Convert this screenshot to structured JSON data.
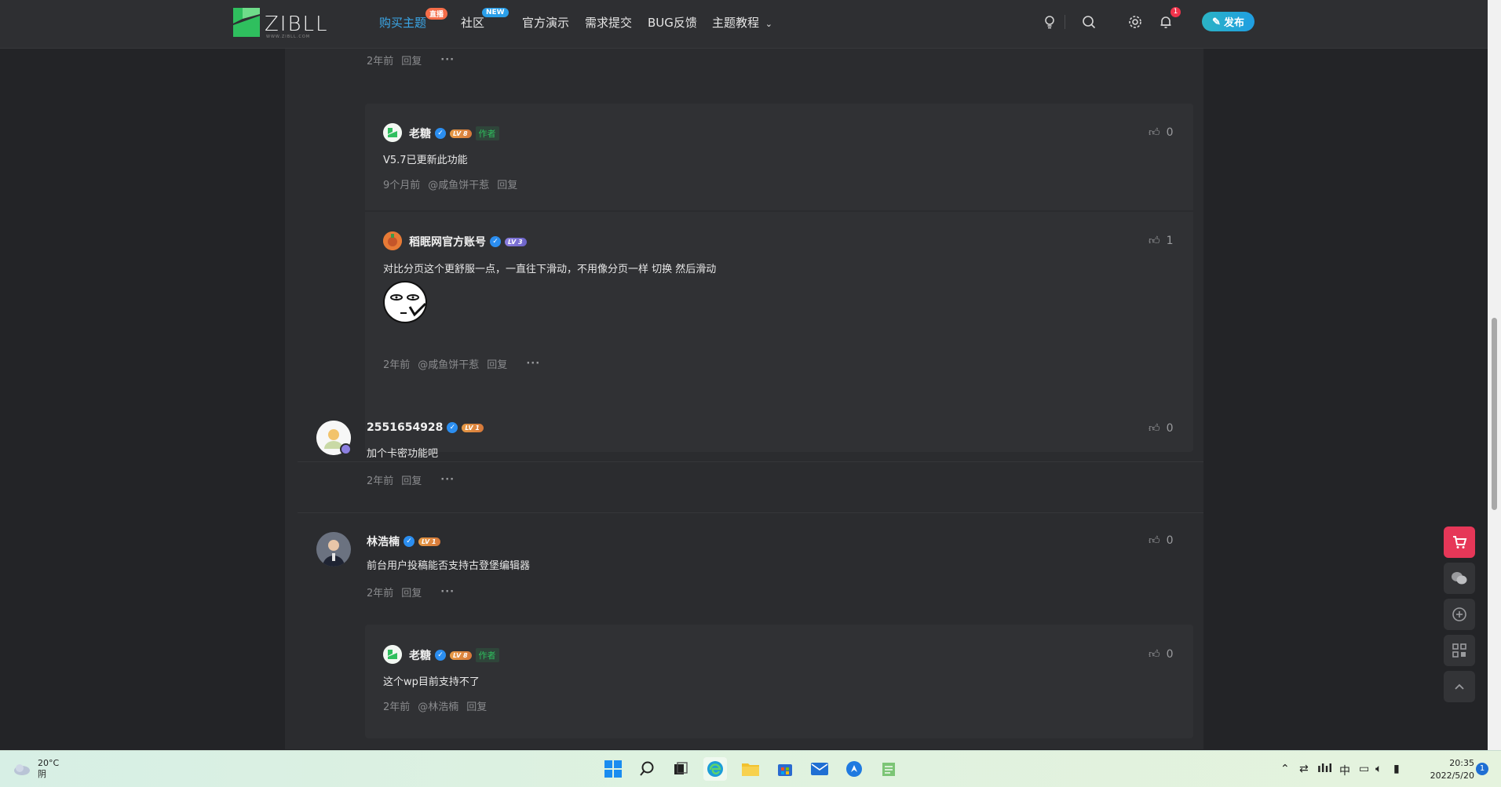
{
  "nav": {
    "logo_text": "ZIBLL",
    "logo_sub": "WWW.ZIBLL.COM",
    "items": [
      {
        "label": "购买主题",
        "badge": "直播"
      },
      {
        "label": "社区",
        "badge": "NEW"
      },
      {
        "label": "官方演示"
      },
      {
        "label": "需求提交"
      },
      {
        "label": "BUG反馈"
      },
      {
        "label": "主题教程"
      }
    ],
    "bell_count": "1",
    "publish_label": "发布"
  },
  "comments": {
    "top_meta": {
      "time": "2年前",
      "reply": "回复"
    },
    "c1": {
      "user": "老糖",
      "level": "LV 8",
      "author_tag": "作者",
      "text": "V5.7已更新此功能",
      "time": "9个月前",
      "mention": "@咸鱼饼干惹",
      "reply": "回复",
      "likes": "0"
    },
    "c2": {
      "user": "稻眠网官方账号",
      "level": "LV 3",
      "text": "对比分页这个更舒服一点，一直往下滑动，不用像分页一样 切换 然后滑动",
      "time": "2年前",
      "mention": "@咸鱼饼干惹",
      "reply": "回复",
      "likes": "1"
    },
    "c3": {
      "user": "2551654928",
      "level": "LV 1",
      "text": "加个卡密功能吧",
      "time": "2年前",
      "reply": "回复",
      "likes": "0"
    },
    "c4": {
      "user": "林浩楠",
      "level": "LV 1",
      "text": "前台用户投稿能否支持古登堡编辑器",
      "time": "2年前",
      "reply": "回复",
      "likes": "0"
    },
    "c5": {
      "user": "老糖",
      "level": "LV 8",
      "author_tag": "作者",
      "text": "这个wp目前支持不了",
      "time": "2年前",
      "mention": "@林浩楠",
      "reply": "回复",
      "likes": "0"
    }
  },
  "taskbar": {
    "temp": "20°C",
    "weather": "阴",
    "ime": "中",
    "time": "20:35",
    "date": "2022/5/20",
    "notif_count": "1"
  },
  "colors": {
    "accent": "#3ba7e8",
    "cart": "#e63758",
    "verified": "#2b8ef0",
    "author": "#2fbf5e"
  }
}
